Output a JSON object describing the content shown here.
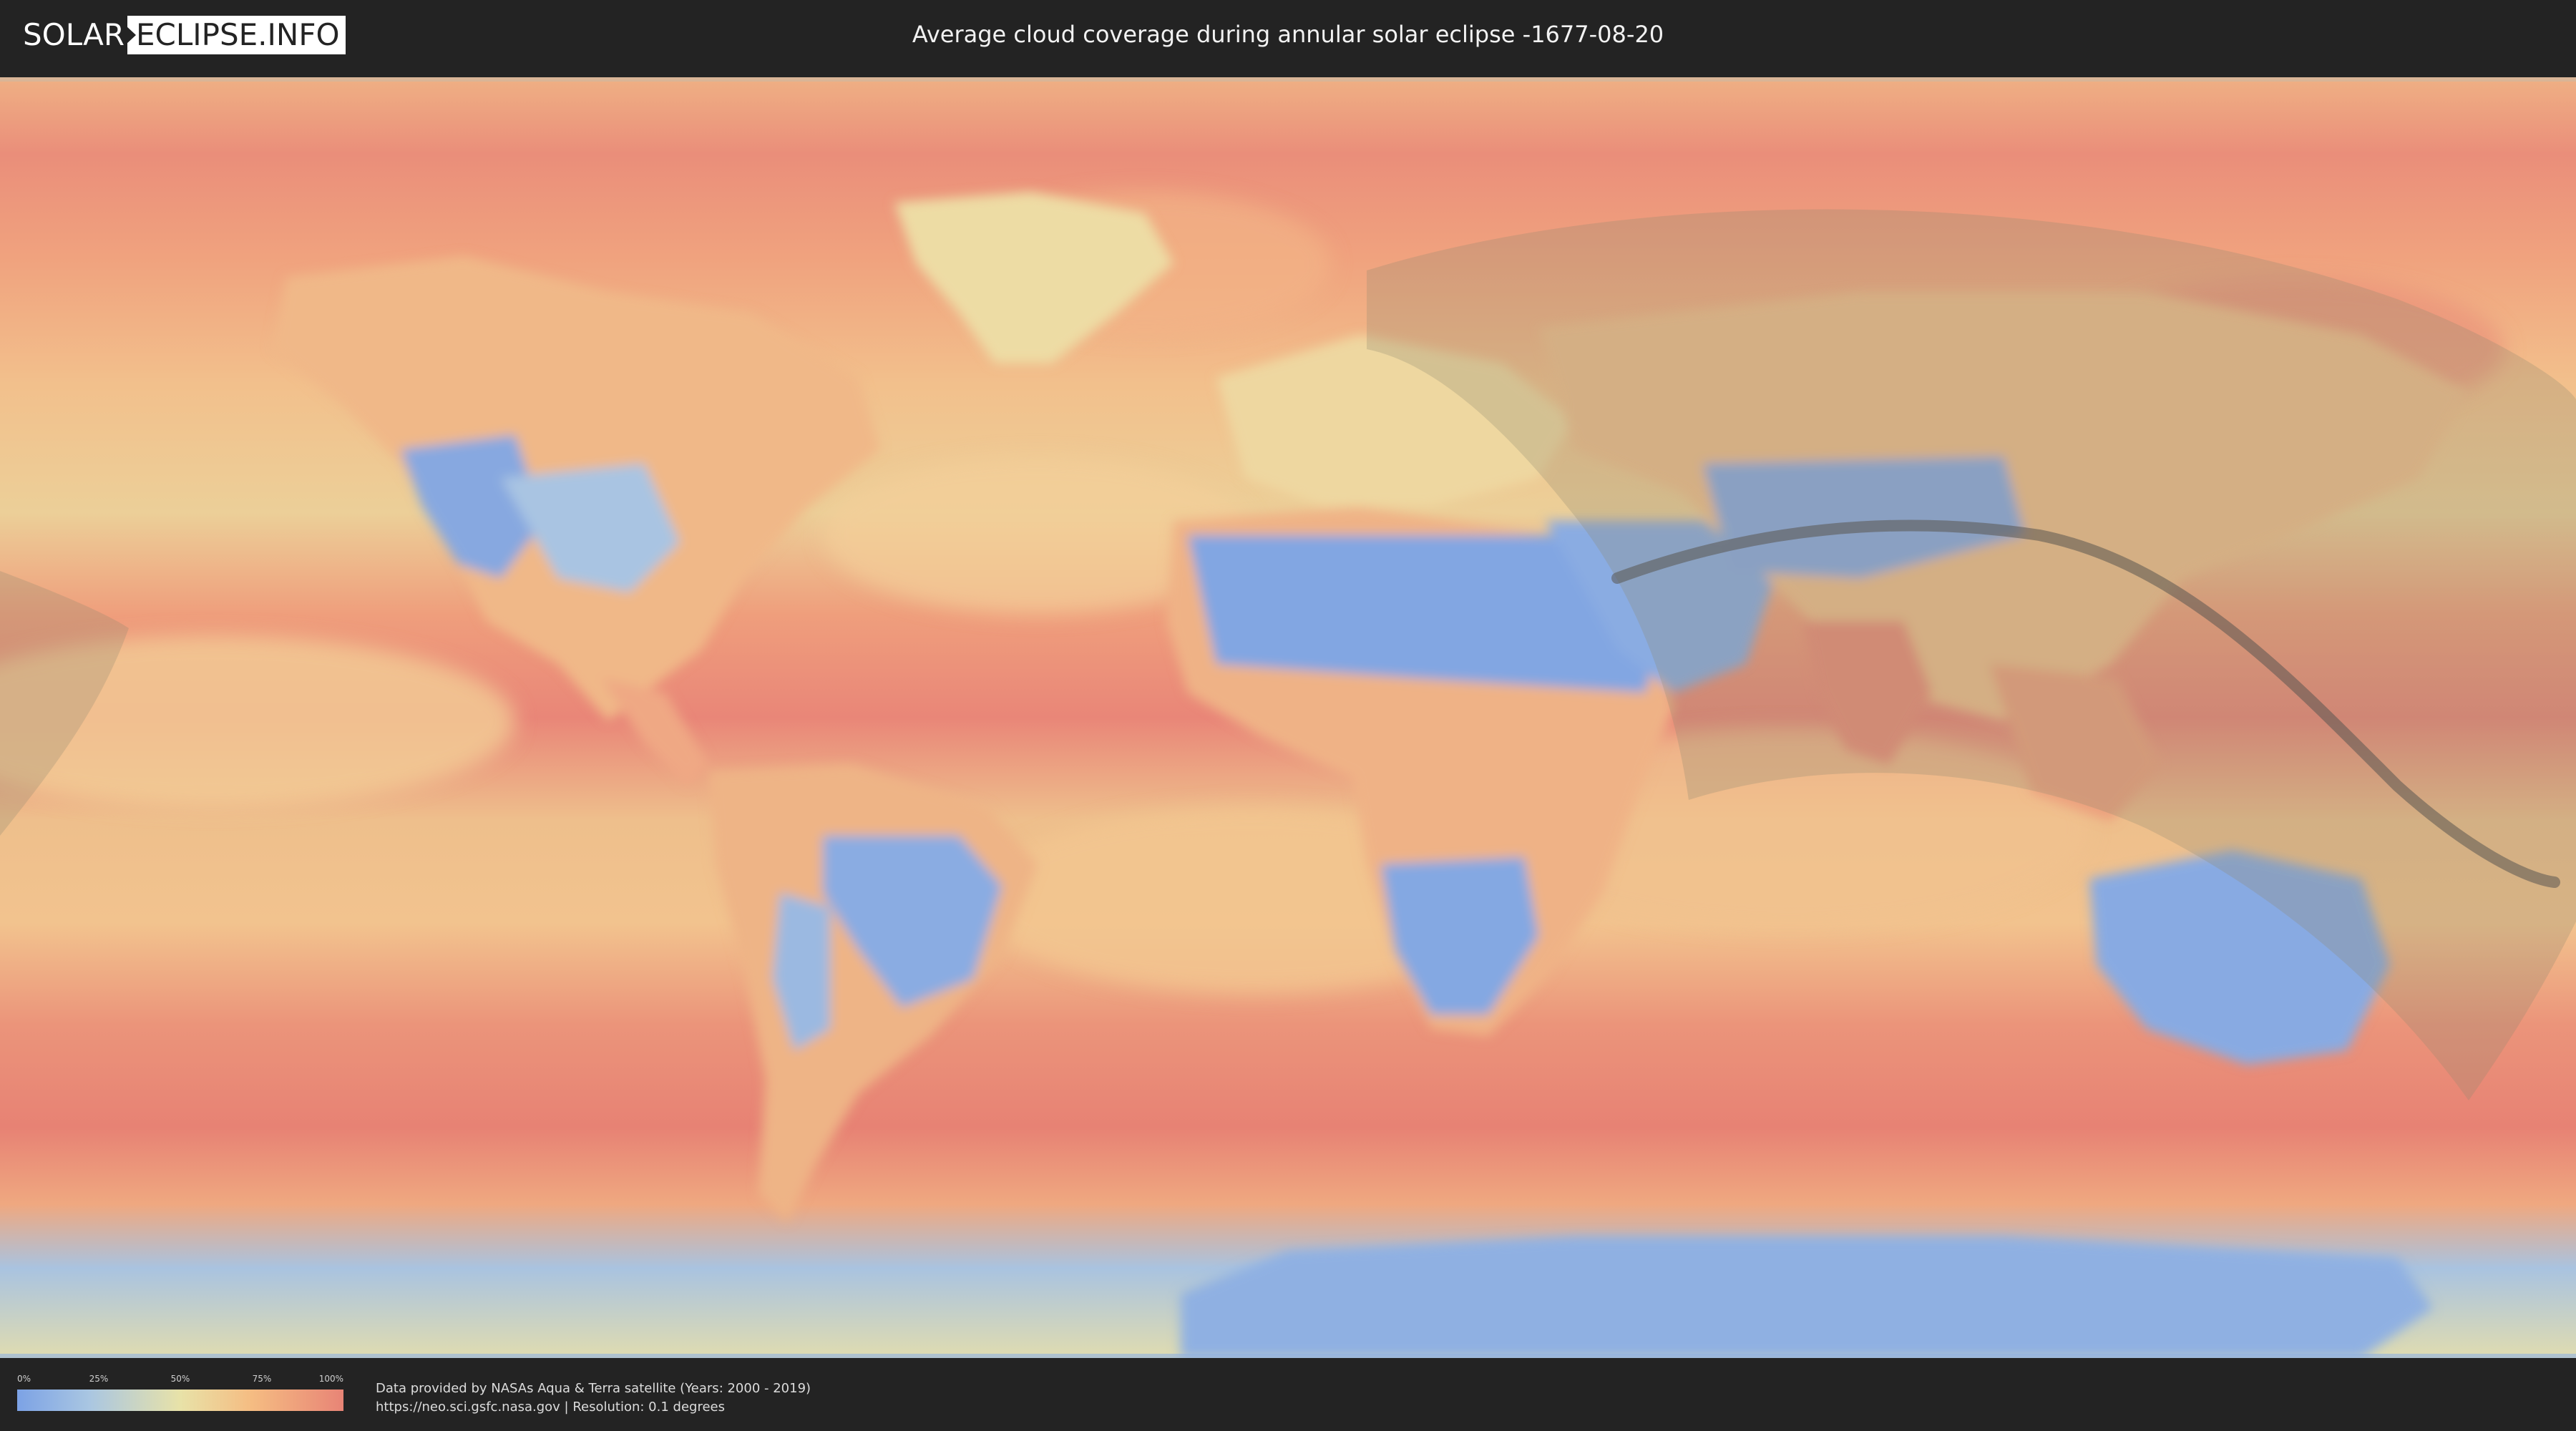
{
  "header": {
    "logo_part1": "SOLAR",
    "logo_part2": "ECLIPSE.INFO",
    "title": "Average cloud coverage during annular solar eclipse -1677-08-20"
  },
  "legend": {
    "ticks": [
      "0%",
      "25%",
      "50%",
      "75%",
      "100%"
    ],
    "tick_values": [
      0,
      25,
      50,
      75,
      100
    ]
  },
  "credits": {
    "line1": "Data provided by NASAs Aqua & Terra satellite (Years: 2000 - 2019)",
    "line2": "https://neo.sci.gsfc.nasa.gov | Resolution: 0.1 degrees"
  },
  "colors": {
    "background": "#232323",
    "cloud_low": "#7ca2e5",
    "cloud_mid": "#e8e2a8",
    "cloud_high": "#e88476",
    "eclipse_band": "#8f8a70",
    "central_line": "#5a5650"
  },
  "map": {
    "projection": "equirectangular",
    "layer": "cloud-coverage",
    "overlay": "eclipse-path"
  }
}
